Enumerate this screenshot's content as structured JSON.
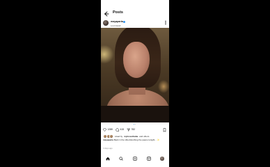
{
  "header": {
    "title": "Posts"
  },
  "post": {
    "username": "mayaparia",
    "subtitle": "Lost island",
    "likes": "128K",
    "comments": "415",
    "shares": "782",
    "liked_by_prefix": "Liked by",
    "liked_by_user": "mylovestbaba",
    "liked_by_suffix": "and others",
    "caption_user": "mayaparia",
    "caption_text": "Back in the villa disturbing the peace tonight...",
    "caption_more": "✨",
    "date": "4 days ago"
  },
  "icons": {
    "back": "back-arrow-icon",
    "more": "more-options-icon",
    "like": "heart-icon",
    "comment": "comment-icon",
    "share": "share-icon",
    "save": "bookmark-icon",
    "home": "home-icon",
    "search": "search-icon",
    "create": "create-icon",
    "reels": "reels-icon",
    "profile": "profile-icon"
  },
  "colors": {
    "accent": "#3897f0",
    "background": "#ffffff",
    "outer": "#000000"
  }
}
